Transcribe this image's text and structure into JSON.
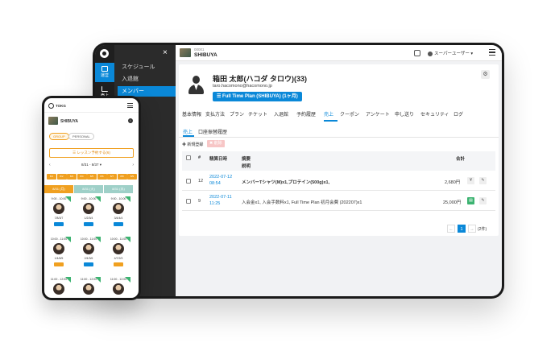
{
  "tablet": {
    "sidebar": {
      "close": "×",
      "rail": [
        {
          "label": "運営",
          "icon": "calendar-icon"
        },
        {
          "label": "売上",
          "icon": "chart-icon"
        }
      ],
      "menu": [
        "スケジュール",
        "入退館",
        "メンバー"
      ],
      "active_menu": "メンバー"
    },
    "topbar": {
      "store_code": "00001",
      "store_name": "SHIBUYA",
      "user_label": "スーパーユーザー ▾"
    },
    "profile": {
      "name": "箱田 太郎(ハコダ タロウ)(33)",
      "email": "taro.hacomono@hacomono.jp",
      "plan": "☰ Full Time Plan (SHIBUYA) (1ヶ月)"
    },
    "tabs": [
      "基本情報",
      "支払方法",
      "プラン",
      "チケット",
      "入退館",
      "予約履歴",
      "売上",
      "クーポン",
      "アンケート",
      "申し送り",
      "セキュリティ",
      "ログ"
    ],
    "active_tab": "売上",
    "subtabs": [
      "売上",
      "口座振替履歴"
    ],
    "actions": {
      "new": "✚ 新規登録",
      "delete": "✖ 削除"
    },
    "table": {
      "headers": {
        "no": "#",
        "date": "精算日時",
        "summary": "摘要",
        "detail": "説明",
        "total": "合計"
      },
      "rows": [
        {
          "no": "12",
          "date": "2022-07-12 08:54",
          "summary": "メンバーTシャツ(M)x1,プロテイン(500g)x1,",
          "total": "2,680円"
        },
        {
          "no": "9",
          "date": "2022-07-11 11:25",
          "summary": "入会金x1, 入会手数料x1, Full Time Plan 初月会費 (202207)x1",
          "total": "25,000円"
        }
      ]
    },
    "pagination": {
      "prev": "←",
      "page": "1",
      "next": "→",
      "count": "(2件)"
    }
  },
  "phone": {
    "brand": "TOKG",
    "store": "SHIBUYA",
    "chips": [
      "GROUP",
      "PERSONAL"
    ],
    "cta": "☰ レッスン予約する(6)",
    "week": "8/31 - 8/37 ▾",
    "days": [
      "8/1",
      "8/2",
      "8/3",
      "8/4",
      "8/5",
      "8/6",
      "8/7",
      "8/8",
      "8/9"
    ],
    "columns": [
      "8/31 (月)",
      "8/31 (火)",
      "8/31 (水)"
    ],
    "column_colors": [
      "#f0a020",
      "#9fd0c8",
      "#9fd0c8"
    ],
    "slots": [
      {
        "time": "9:00 - 10:00",
        "num": "7/8/3/7",
        "tag": "blue"
      },
      {
        "time": "9:00 - 10:00",
        "num": "1/2/3/4",
        "tag": "blue"
      },
      {
        "time": "9:00 - 10:00",
        "num": "3/4/4/4",
        "tag": "blue"
      },
      {
        "time": "10:00 - 11:00",
        "num": "1/4/6/5",
        "tag": "orange"
      },
      {
        "time": "10:00 - 11:00",
        "num": "2/4/3/6",
        "tag": "blue"
      },
      {
        "time": "10:00 - 11:00",
        "num": "4/7/2/3",
        "tag": "orange"
      },
      {
        "time": "11:00 - 12:00",
        "num": "",
        "tag": ""
      },
      {
        "time": "11:00 - 12:00",
        "num": "",
        "tag": ""
      },
      {
        "time": "11:00 - 12:00",
        "num": "",
        "tag": ""
      }
    ]
  }
}
